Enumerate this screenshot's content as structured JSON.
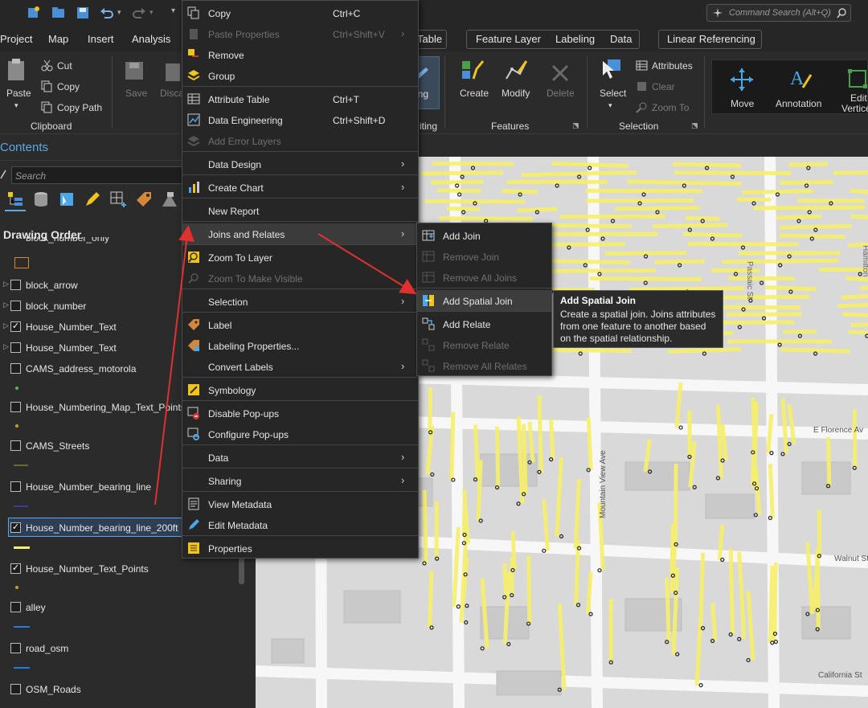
{
  "app": {
    "command_search_placeholder": "Command Search (Alt+Q)"
  },
  "ribbon_tabs": {
    "project": "Project",
    "map": "Map",
    "insert": "Insert",
    "analysis": "Analysis",
    "table": "Table",
    "feature_layer": "Feature Layer",
    "labeling": "Labeling",
    "data": "Data",
    "linear_referencing": "Linear Referencing"
  },
  "ribbon": {
    "paste": "Paste",
    "cut": "Cut",
    "copy": "Copy",
    "copy_path": "Copy Path",
    "clipboard_group": "Clipboard",
    "save": "Save",
    "discard": "Disca",
    "editing_partial": "ing",
    "editing_group_partial": "iting",
    "create": "Create",
    "modify": "Modify",
    "delete": "Delete",
    "features_group": "Features",
    "select": "Select",
    "attributes": "Attributes",
    "clear": "Clear",
    "zoom_to": "Zoom To",
    "selection_group": "Selection",
    "move": "Move",
    "annotation": "Annotation",
    "edit_vertices_1": "Edit",
    "edit_vertices_2": "Vertice"
  },
  "contents": {
    "title": "Contents",
    "search_placeholder": "Search",
    "drawing_order": "Drawing Order",
    "layers": [
      {
        "name": "block_number_only",
        "checked": false,
        "expander": false
      },
      {
        "name": "block_arrow",
        "checked": false,
        "expander": true
      },
      {
        "name": "block_number",
        "checked": false,
        "expander": true
      },
      {
        "name": "House_Number_Text",
        "checked": true,
        "expander": true
      },
      {
        "name": "House_Number_Text",
        "checked": false,
        "expander": true
      },
      {
        "name": "CAMS_address_motorola",
        "checked": false,
        "expander": false
      },
      {
        "name": "House_Numbering_Map_Text_Points",
        "checked": false,
        "expander": false
      },
      {
        "name": "CAMS_Streets",
        "checked": false,
        "expander": false
      },
      {
        "name": "House_Number_bearing_line",
        "checked": false,
        "expander": false
      },
      {
        "name": "House_Number_bearing_line_200ft",
        "checked": true,
        "expander": false,
        "selected": true
      },
      {
        "name": "House_Number_Text_Points",
        "checked": true,
        "expander": false
      },
      {
        "name": "alley",
        "checked": false,
        "expander": false
      },
      {
        "name": "road_osm",
        "checked": false,
        "expander": false
      },
      {
        "name": "OSM_Roads",
        "checked": false,
        "expander": false
      }
    ]
  },
  "context_menu": {
    "copy": "Copy",
    "copy_sc": "Ctrl+C",
    "paste_properties": "Paste Properties",
    "paste_properties_sc": "Ctrl+Shift+V",
    "remove": "Remove",
    "group": "Group",
    "attribute_table": "Attribute Table",
    "attribute_table_sc": "Ctrl+T",
    "data_engineering": "Data Engineering",
    "data_engineering_sc": "Ctrl+Shift+D",
    "add_error_layers": "Add Error Layers",
    "data_design": "Data Design",
    "create_chart": "Create Chart",
    "new_report": "New Report",
    "joins_and_relates": "Joins and Relates",
    "zoom_to_layer": "Zoom To Layer",
    "zoom_to_make_visible": "Zoom To Make Visible",
    "selection": "Selection",
    "label": "Label",
    "labeling_properties": "Labeling Properties...",
    "convert_labels": "Convert Labels",
    "symbology": "Symbology",
    "disable_popups": "Disable Pop-ups",
    "configure_popups": "Configure Pop-ups",
    "data": "Data",
    "sharing": "Sharing",
    "view_metadata": "View Metadata",
    "edit_metadata": "Edit Metadata",
    "properties": "Properties"
  },
  "submenu": {
    "add_join": "Add Join",
    "remove_join": "Remove Join",
    "remove_all_joins": "Remove All Joins",
    "add_spatial_join": "Add Spatial Join",
    "add_relate": "Add Relate",
    "remove_relate": "Remove Relate",
    "remove_all_relates": "Remove All Relates"
  },
  "tooltip": {
    "title": "Add Spatial Join",
    "body": "Create a spatial join. Joins attributes from one feature to another based on the spatial relationship."
  },
  "map_labels": {
    "passaic": "Passaic St",
    "florence": "E Florence Av",
    "mountain_view": "Mountain View Ave",
    "walnut": "Walnut St",
    "california": "California St",
    "hamilton": "Hamilton"
  },
  "colors": {
    "accent_blue": "#5aa8e8",
    "highlight_yellow": "#f7f06a",
    "annotation_red": "#e03030"
  }
}
